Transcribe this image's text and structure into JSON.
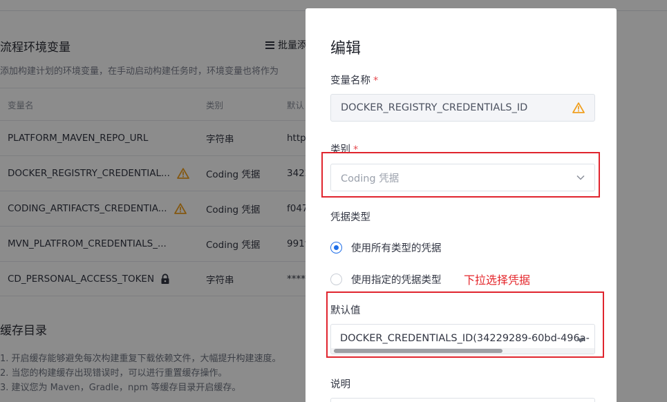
{
  "background": {
    "section_title": "流程环境变量",
    "batch_label": "批量添",
    "description": "添加构建计划的环境变量，在手动启动构建任务时，环境变量也将作为",
    "table": {
      "headers": [
        "变量名",
        "类别",
        "默认"
      ],
      "rows": [
        {
          "name": "PLATFORM_MAVEN_REPO_URL",
          "type": "字符串",
          "value": "http",
          "icon": ""
        },
        {
          "name": "DOCKER_REGISTRY_CREDENTIAL...",
          "type": "Coding 凭据",
          "value": "3422",
          "icon": "warning-icon"
        },
        {
          "name": "CODING_ARTIFACTS_CREDENTIA...",
          "type": "Coding 凭据",
          "value": "f047",
          "icon": "warning-icon"
        },
        {
          "name": "MVN_PLATFROM_CREDENTIALS_...",
          "type": "Coding 凭据",
          "value": "991f",
          "icon": ""
        },
        {
          "name": "CD_PERSONAL_ACCESS_TOKEN",
          "type": "字符串",
          "value": "*****",
          "icon": "lock-icon"
        }
      ]
    },
    "cache_title": "缓存目录",
    "cache_notes": [
      "1. 开启缓存能够避免每次构建重复下载依赖文件，大幅提升构建速度。",
      "2. 当您的构建缓存出现错误时，可以进行重置缓存操作。",
      "3. 建议您为 Maven，Gradle，npm 等缓存目录开启缓存。"
    ]
  },
  "dialog": {
    "title": "编辑",
    "name_label": "变量名称",
    "required_mark": "*",
    "name_value": "DOCKER_REGISTRY_CREDENTIALS_ID",
    "type_label": "类别",
    "type_value": "Coding 凭据",
    "cred_type_label": "凭据类型",
    "radio_all": "使用所有类型的凭据",
    "radio_specific": "使用指定的凭据类型",
    "annotation": "下拉选择凭据",
    "default_label": "默认值",
    "default_value": "DOCKER_CREDENTIALS_ID(34229289-60bd-496a-",
    "desc_label": "说明"
  },
  "colors": {
    "accent": "#1e6ee8",
    "warning": "#f0a020",
    "annotation_red": "#e0242d"
  }
}
